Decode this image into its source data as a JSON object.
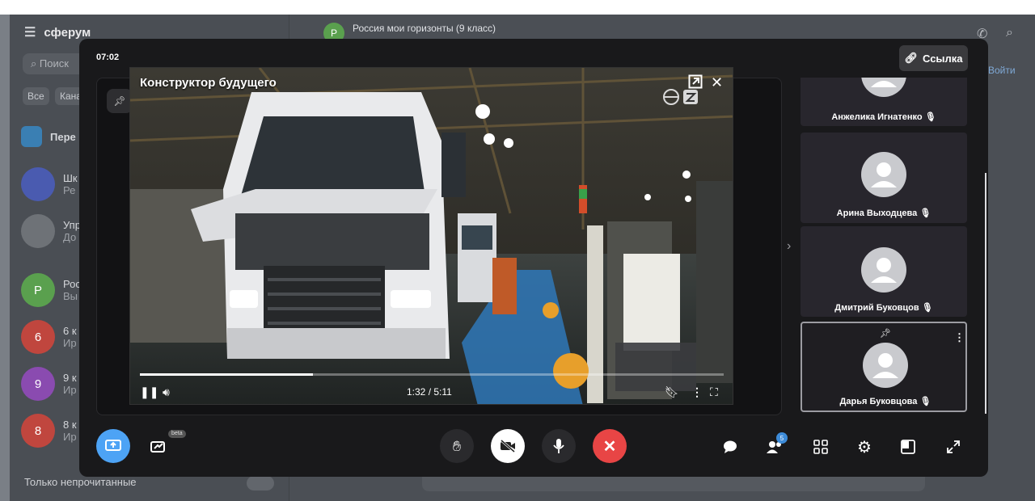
{
  "background_app": {
    "brand": "сферум",
    "search_placeholder": "Поиск",
    "filters": [
      "Все",
      "Кана"
    ],
    "pinned_item": "Пере",
    "chats": [
      {
        "title": "Шк",
        "subtitle": "Ре",
        "color": "#4a5bb0"
      },
      {
        "title": "Упр",
        "subtitle": "До",
        "color": "#6e7277"
      },
      {
        "title": "Рос",
        "subtitle": "Вы",
        "avatar_letter": "Р",
        "color": "#5aa04e"
      },
      {
        "title": "6 к",
        "subtitle": "Ир",
        "avatar_letter": "6",
        "color": "#c0463e"
      },
      {
        "title": "9 к",
        "subtitle": "Ир",
        "avatar_letter": "9",
        "color": "#8a4bb0"
      },
      {
        "title": "8 к",
        "subtitle": "Ир",
        "avatar_letter": "8",
        "color": "#c0463e"
      }
    ],
    "unread_only_label": "Только непрочитанные",
    "open_chat_title": "Россия мои горизонты (9 класс)",
    "open_chat_subtitle": "Войти",
    "chat_avatar_letter": "Р"
  },
  "call": {
    "timer": "07:02",
    "link_button": "Ссылка",
    "video": {
      "title": "Конструктор будущего",
      "time": "1:32 / 5:11",
      "progress": 0.296
    },
    "participants": [
      {
        "name": "Анжелика Игнатенко"
      },
      {
        "name": "Арина Выходцева"
      },
      {
        "name": "Дмитрий Буковцов"
      },
      {
        "name": "Дарья Буковцова"
      }
    ],
    "beta_label": "beta",
    "participants_count": "5",
    "colors": {
      "end_call": "#e84545",
      "share": "#4da3f5",
      "modal": "#19191b"
    }
  }
}
